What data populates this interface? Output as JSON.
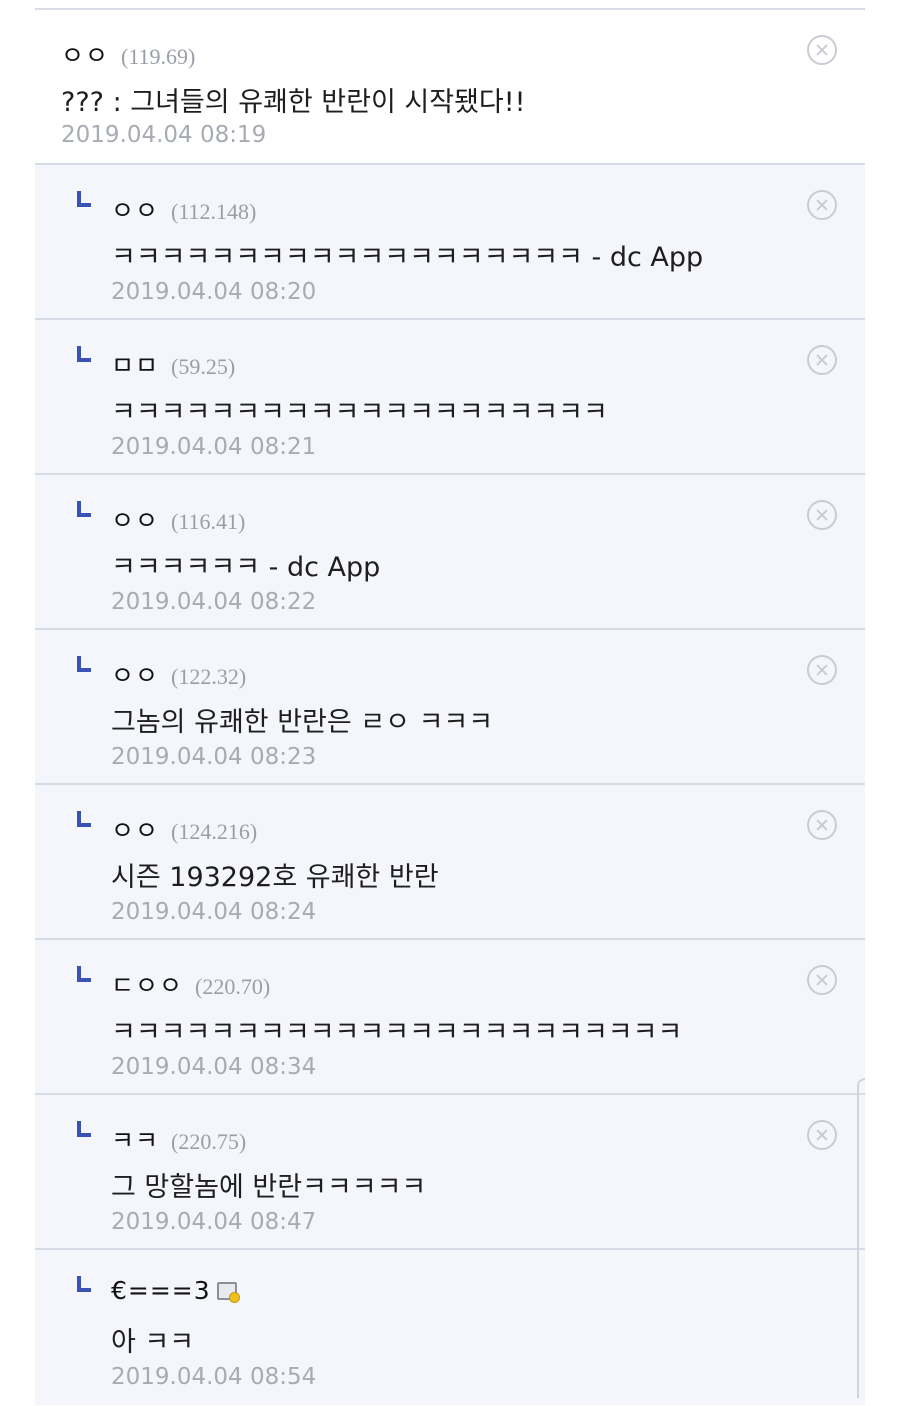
{
  "comments": [
    {
      "nick": "ㅇㅇ",
      "ip": "(119.69)",
      "text": "??? : 그녀들의 유쾌한 반란이 시작됐다!!",
      "date": "2019.04.04 08:19"
    },
    {
      "nick": "ㅇㅇ",
      "ip": "(112.148)",
      "text": "ㅋㅋㅋㅋㅋㅋㅋㅋㅋㅋㅋㅋㅋㅋㅋㅋㅋㅋㅋ - dc App",
      "date": "2019.04.04 08:20"
    },
    {
      "nick": "ㅁㅁ",
      "ip": "(59.25)",
      "text": "ㅋㅋㅋㅋㅋㅋㅋㅋㅋㅋㅋㅋㅋㅋㅋㅋㅋㅋㅋㅋ",
      "date": "2019.04.04 08:21"
    },
    {
      "nick": "ㅇㅇ",
      "ip": "(116.41)",
      "text": "ㅋㅋㅋㅋㅋㅋ - dc App",
      "date": "2019.04.04 08:22"
    },
    {
      "nick": "ㅇㅇ",
      "ip": "(122.32)",
      "text": "그놈의 유쾌한 반란은 ㄹㅇ ㅋㅋㅋ",
      "date": "2019.04.04 08:23"
    },
    {
      "nick": "ㅇㅇ",
      "ip": "(124.216)",
      "text": "시즌 193292호 유쾌한 반란",
      "date": "2019.04.04 08:24"
    },
    {
      "nick": "ㄷㅇㅇ",
      "ip": "(220.70)",
      "text": "ㅋㅋㅋㅋㅋㅋㅋㅋㅋㅋㅋㅋㅋㅋㅋㅋㅋㅋㅋㅋㅋㅋㅋ",
      "date": "2019.04.04 08:34"
    },
    {
      "nick": "ㅋㅋ",
      "ip": "(220.75)",
      "text": "그 망할놈에 반란ㅋㅋㅋㅋㅋ",
      "date": "2019.04.04 08:47"
    },
    {
      "nick": "€===3",
      "text": "아 ㅋㅋ",
      "date": "2019.04.04 08:54"
    }
  ],
  "icons": {
    "delete": "close-circle-icon",
    "reply": "reply-arrow-icon",
    "memo": "memo-icon"
  },
  "colors": {
    "reply_bg": "#f4f6fb",
    "reply_mark": "#3a52b3",
    "divider": "#d6dbe6"
  }
}
